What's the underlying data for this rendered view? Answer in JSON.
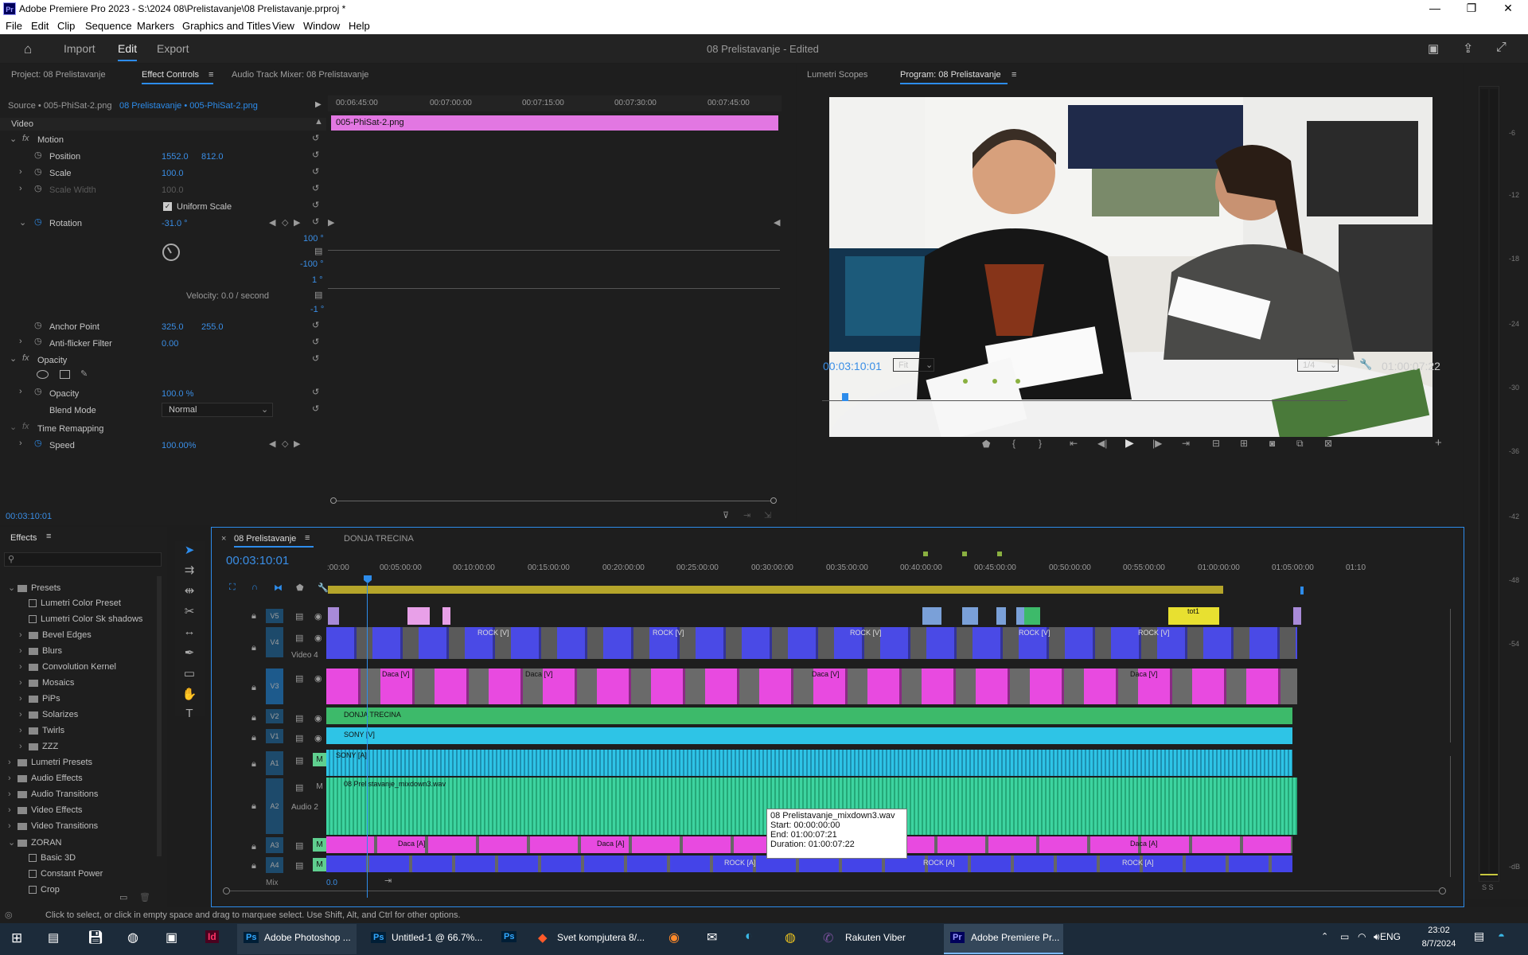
{
  "window": {
    "title": "Adobe Premiere Pro 2023 - S:\\2024 08\\Prelistavanje\\08 Prelistavanje.prproj *",
    "app_badge": "Pr"
  },
  "menu": [
    "File",
    "Edit",
    "Clip",
    "Sequence",
    "Markers",
    "Graphics and Titles",
    "View",
    "Window",
    "Help"
  ],
  "workspace": {
    "tabs": [
      "Import",
      "Edit",
      "Export"
    ],
    "active": "Edit",
    "project_title": "08 Prelistavanje",
    "edited_suffix": " - Edited"
  },
  "source_panel": {
    "tabs": [
      "Project: 08 Prelistavanje",
      "Effect Controls",
      "Audio Track Mixer: 08 Prelistavanje"
    ],
    "source_label": "Source • 005-PhiSat-2.png",
    "sequence_clip": "08 Prelistavanje • 005-PhiSat-2.png",
    "ruler_times": [
      "00:06:45:00",
      "00:07:00:00",
      "00:07:15:00",
      "00:07:30:00",
      "00:07:45:00"
    ],
    "clip_name": "005-PhiSat-2.png",
    "section_video": "Video",
    "motion": "Motion",
    "position_label": "Position",
    "position_x": "1552.0",
    "position_y": "812.0",
    "scale_label": "Scale",
    "scale_val": "100.0",
    "scale_width_label": "Scale Width",
    "scale_width_val": "100.0",
    "uniform_scale": "Uniform Scale",
    "rotation_label": "Rotation",
    "rotation_val": "-31.0 °",
    "graph_top": "100 °",
    "graph_bottom": "-100 °",
    "graph2_top": "1 °",
    "graph2_bottom": "-1 °",
    "velocity": "Velocity: 0.0 / second",
    "anchor_label": "Anchor Point",
    "anchor_x": "325.0",
    "anchor_y": "255.0",
    "antiflicker_label": "Anti-flicker Filter",
    "antiflicker_val": "0.00",
    "opacity_section": "Opacity",
    "opacity_label": "Opacity",
    "opacity_val": "100.0 %",
    "blend_label": "Blend Mode",
    "blend_val": "Normal",
    "time_remap": "Time Remapping",
    "speed_label": "Speed",
    "speed_val": "100.00%",
    "timecode": "00:03:10:01"
  },
  "program_panel": {
    "tabs": [
      "Lumetri Scopes",
      "Program: 08 Prelistavanje"
    ],
    "timecode": "00:03:10:01",
    "fit": "Fit",
    "resolution": "1/4",
    "duration": "01:00:07:22"
  },
  "effects_panel": {
    "title": "Effects",
    "items": [
      {
        "label": "Presets",
        "level": 0,
        "type": "folder",
        "open": true
      },
      {
        "label": "Lumetri Color Preset",
        "level": 1,
        "type": "preset"
      },
      {
        "label": "Lumetri Color Sk shadows",
        "level": 1,
        "type": "preset"
      },
      {
        "label": "Bevel Edges",
        "level": 1,
        "type": "folder"
      },
      {
        "label": "Blurs",
        "level": 1,
        "type": "folder"
      },
      {
        "label": "Convolution Kernel",
        "level": 1,
        "type": "folder"
      },
      {
        "label": "Mosaics",
        "level": 1,
        "type": "folder"
      },
      {
        "label": "PiPs",
        "level": 1,
        "type": "folder"
      },
      {
        "label": "Solarizes",
        "level": 1,
        "type": "folder"
      },
      {
        "label": "Twirls",
        "level": 1,
        "type": "folder"
      },
      {
        "label": "ZZZ",
        "level": 1,
        "type": "folder"
      },
      {
        "label": "Lumetri Presets",
        "level": 0,
        "type": "folder"
      },
      {
        "label": "Audio Effects",
        "level": 0,
        "type": "folder"
      },
      {
        "label": "Audio Transitions",
        "level": 0,
        "type": "folder"
      },
      {
        "label": "Video Effects",
        "level": 0,
        "type": "folder"
      },
      {
        "label": "Video Transitions",
        "level": 0,
        "type": "folder"
      },
      {
        "label": "ZORAN",
        "level": 0,
        "type": "folder",
        "open": true
      },
      {
        "label": "Basic 3D",
        "level": 1,
        "type": "preset"
      },
      {
        "label": "Constant Power",
        "level": 1,
        "type": "preset"
      },
      {
        "label": "Crop",
        "level": 1,
        "type": "preset"
      }
    ]
  },
  "timeline": {
    "tabs": [
      "08 Prelistavanje",
      "DONJA TRECINA"
    ],
    "timecode": "00:03:10:01",
    "ruler": [
      ":00:00",
      "00:05:00:00",
      "00:10:00:00",
      "00:15:00:00",
      "00:20:00:00",
      "00:25:00:00",
      "00:30:00:00",
      "00:35:00:00",
      "00:40:00:00",
      "00:45:00:00",
      "00:50:00:00",
      "00:55:00:00",
      "01:00:00:00",
      "01:05:00:00",
      "01:10"
    ],
    "tracks": [
      {
        "id": "V5",
        "name": ""
      },
      {
        "id": "V4",
        "name": "Video 4"
      },
      {
        "id": "V3",
        "name": ""
      },
      {
        "id": "V2",
        "name": ""
      },
      {
        "id": "V1",
        "name": ""
      },
      {
        "id": "A1",
        "name": ""
      },
      {
        "id": "A2",
        "name": "Audio 2"
      },
      {
        "id": "A3",
        "name": ""
      },
      {
        "id": "A4",
        "name": ""
      }
    ],
    "mix_label": "Mix",
    "mix_val": "0.0",
    "clip_labels": {
      "tot1": "tot1",
      "rock_v": "ROCK [V]",
      "daca_v": "Daca [V]",
      "donja": "DONJA TRECINA",
      "sony_v": "SONY [V]",
      "sony_a": "SONY [A]",
      "mixdown": "08 Prelistavanje_mixdown3.wav",
      "daca_a": "Daca [A]",
      "rock_a": "ROCK [A]"
    },
    "tooltip": {
      "name": "08 Prelistavanje_mixdown3.wav",
      "start": "Start: 00:00:00:00",
      "end": "End: 01:00:07:21",
      "duration": "Duration: 01:00:07:22"
    }
  },
  "vu_scale": [
    "-6",
    "-12",
    "-18",
    "-24",
    "-30",
    "-36",
    "-42",
    "-48",
    "-54",
    "-dB"
  ],
  "vu_bottom": "S S",
  "status": "Click to select, or click in empty space and drag to marquee select. Use Shift, Alt, and Ctrl for other options.",
  "taskbar": {
    "items": [
      "Adobe Photoshop ...",
      "Untitled-1 @ 66.7%...",
      "Svet kompjutera 8/...",
      "Rakuten Viber",
      "Adobe Premiere Pr..."
    ],
    "lang": "ENG",
    "time": "23:02",
    "date": "8/7/2024"
  },
  "colors": {
    "accent": "#2d8ceb",
    "pink": "#e84ae0",
    "blue": "#4444e8",
    "green": "#3dba6a",
    "cyan": "#2ec4e6",
    "yellow": "#e8e030"
  }
}
